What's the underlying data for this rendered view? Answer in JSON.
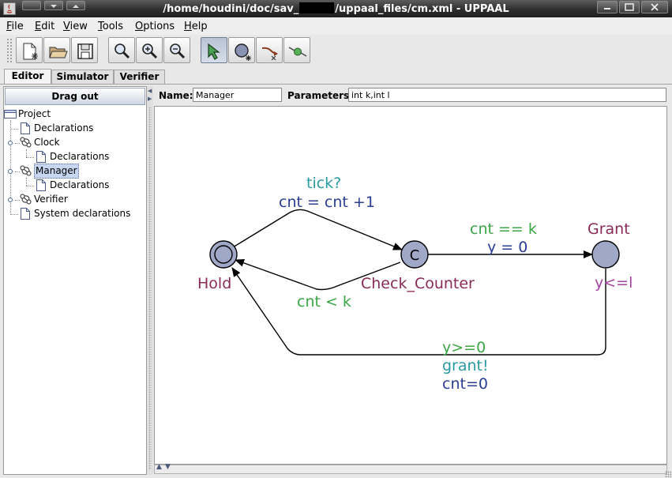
{
  "window": {
    "title_prefix": "/home/houdini/doc/sav_",
    "title_suffix": "/uppaal_files/cm.xml - UPPAAL"
  },
  "menu": {
    "items": [
      {
        "ul": "F",
        "rest": "ile"
      },
      {
        "ul": "E",
        "rest": "dit"
      },
      {
        "ul": "V",
        "rest": "iew"
      },
      {
        "ul": "T",
        "rest": "ools"
      },
      {
        "ul": "O",
        "rest": "ptions"
      },
      {
        "ul": "H",
        "rest": "elp"
      }
    ]
  },
  "toolbar": {
    "buttons": [
      "new-document-icon",
      "open-folder-icon",
      "save-disk-icon",
      "zoom-fit-icon",
      "zoom-in-icon",
      "zoom-out-icon",
      "select-arrow-tool-icon",
      "add-location-tool-icon",
      "add-edge-tool-icon",
      "add-nail-tool-icon"
    ],
    "active_tool": "select-arrow-tool-icon"
  },
  "tabs": [
    {
      "label": "Editor",
      "active": true
    },
    {
      "label": "Simulator",
      "active": false
    },
    {
      "label": "Verifier",
      "active": false
    }
  ],
  "left_panel": {
    "drag_out_label": "Drag out",
    "tree": {
      "project": "Project",
      "declarations": "Declarations",
      "clock": "Clock",
      "clock_declarations": "Declarations",
      "manager": "Manager",
      "manager_declarations": "Declarations",
      "verifier": "Verifier",
      "system_declarations": "System declarations"
    },
    "selected": "Manager"
  },
  "template_fields": {
    "name_label": "Name:",
    "name_value": "Manager",
    "parameters_label": "Parameters:",
    "parameters_value": "int k,int l"
  },
  "automaton": {
    "colors": {
      "location_fill": "#a0a8c8",
      "location_name": "#8a2a56",
      "guard": "#3aa646",
      "sync": "#2a9aa2",
      "update": "#2a3e96",
      "invariant": "#a2449e"
    },
    "locations": {
      "hold": {
        "name": "Hold",
        "initial": true
      },
      "check_counter": {
        "name": "Check_Counter",
        "committed_marker": "C"
      },
      "grant": {
        "name": "Grant",
        "invariant": "y<=l"
      }
    },
    "edges": {
      "hold_to_check": {
        "sync": "tick?",
        "update": "cnt = cnt +1"
      },
      "check_to_hold": {
        "guard": "cnt < k"
      },
      "check_to_grant": {
        "guard": "cnt == k",
        "update": "y = 0"
      },
      "grant_to_hold": {
        "guard": "y>=0",
        "sync": "grant!",
        "update": "cnt=0"
      }
    }
  }
}
